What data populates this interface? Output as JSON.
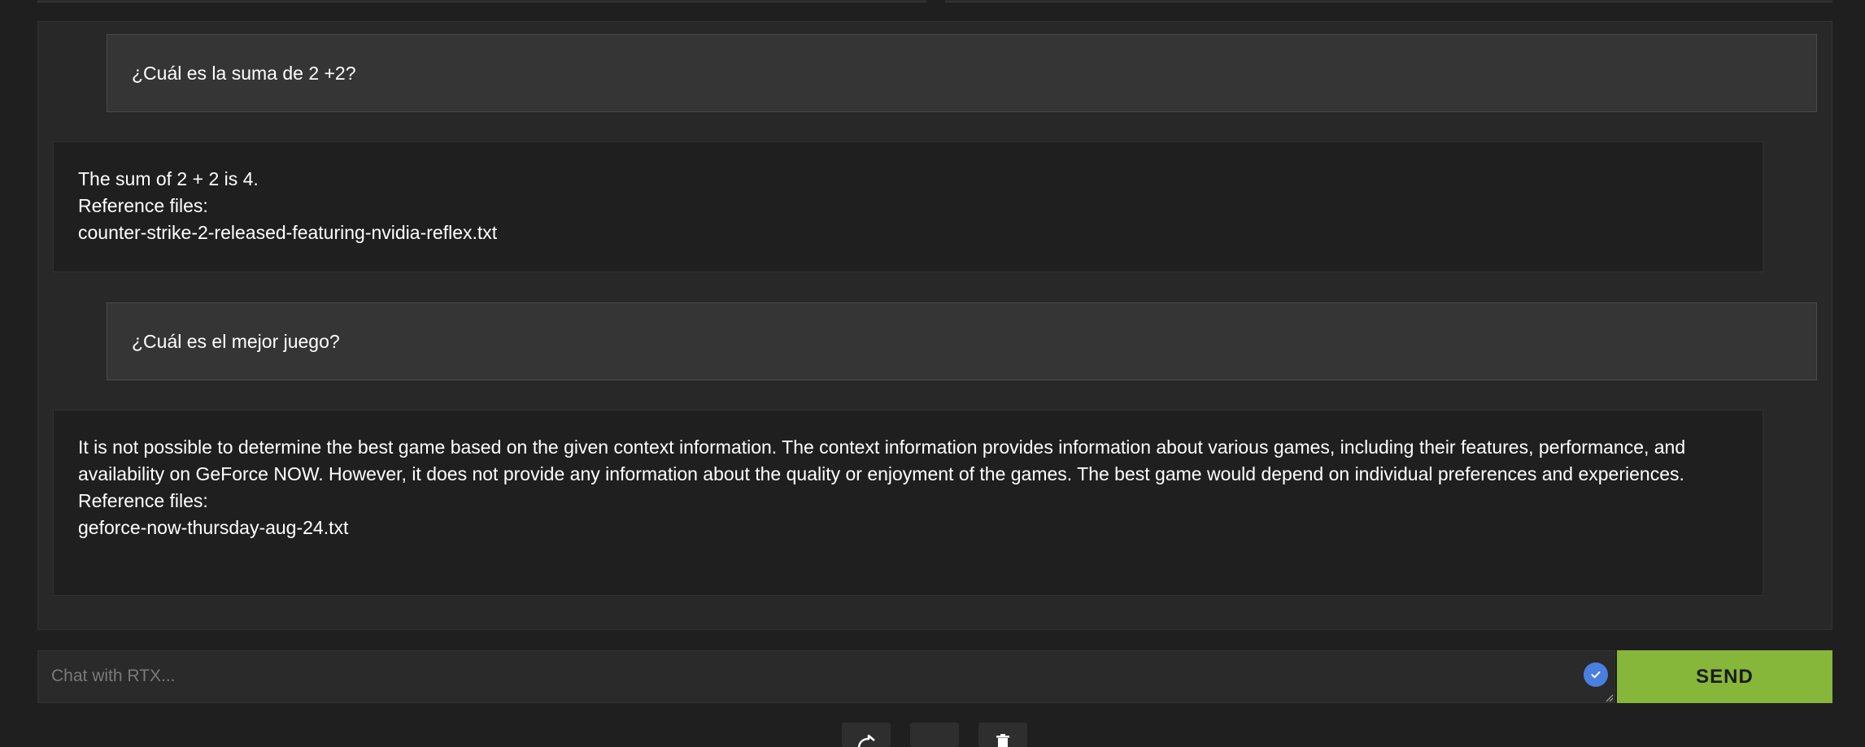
{
  "messages": [
    {
      "role": "user",
      "lines": [
        "¿Cuál es la suma de 2 +2?"
      ]
    },
    {
      "role": "assistant",
      "lines": [
        "The sum of 2 + 2 is 4.",
        "Reference files:",
        "counter-strike-2-released-featuring-nvidia-reflex.txt"
      ]
    },
    {
      "role": "user",
      "lines": [
        "¿Cuál es el mejor juego?"
      ]
    },
    {
      "role": "assistant",
      "lines": [
        "It is not possible to determine the best game based on the given context information. The context information provides information about various games, including their features, performance, and availability on GeForce NOW. However, it does not provide any information about the quality or enjoyment of the games. The best game would depend on individual preferences and experiences.",
        "Reference files:",
        "geforce-now-thursday-aug-24.txt"
      ]
    }
  ],
  "input": {
    "placeholder": "Chat with RTX...",
    "value": ""
  },
  "send_button": {
    "label": "SEND"
  },
  "toolbar": {
    "icons": [
      "share-icon",
      "blank-icon",
      "trash-icon"
    ]
  },
  "colors": {
    "background": "#1f1f1f",
    "panel": "#282828",
    "user_bubble": "#353535",
    "assistant_bubble": "#1f1f1f",
    "accent_green": "#86b63a",
    "check_blue": "#4a7fe0"
  }
}
